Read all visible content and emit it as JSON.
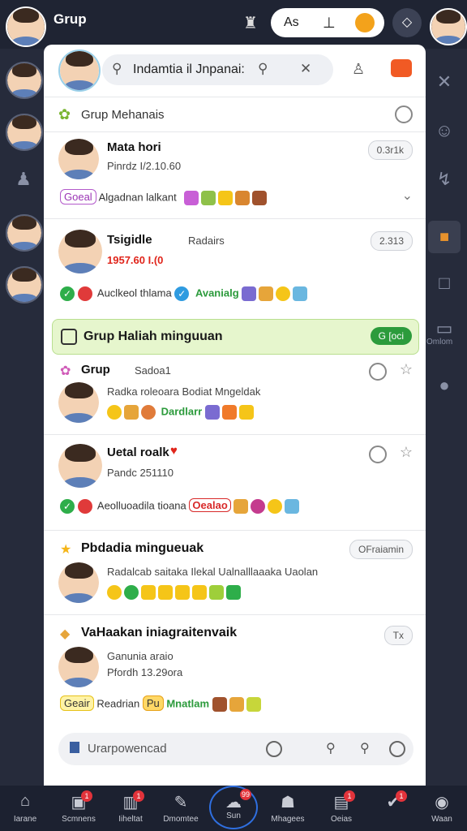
{
  "topbar": {
    "title": "Grup",
    "pill_text": "As"
  },
  "search": {
    "value": "Indamtia il Jnpanai:"
  },
  "section": {
    "title": "Grup Mehanais"
  },
  "rows": [
    {
      "name": "Mata hori",
      "sub": "Pinrdz I/2.10.60",
      "badge": "0.3r1k",
      "tag": "Goeal",
      "line": "Algadnan lalkant"
    },
    {
      "name": "Tsigidle",
      "sub": "1957.60 I.(0",
      "badge": "2.313",
      "extra": "Radairs",
      "line": "Auclkeol thlama",
      "tag2": "Avanialg"
    },
    {
      "name": "Grup",
      "sub": "Radka roleoara Bodiat Mngeldak",
      "extra": "Sadoa1",
      "line": "Dardlarr"
    },
    {
      "name": "Uetal roalk",
      "sub": "Pandc 251110",
      "line": "Aeolluoadila tioana",
      "tag": "Oealao"
    },
    {
      "name": "Pbdadia mingueuak",
      "sub": "Radalcab saitaka Ilekal Ualnalllaaaka Uaolan",
      "badge": "OFraiamin"
    },
    {
      "name": "VaHaakan iniagraitenvaik",
      "sub": "Ganunia araio",
      "sub2": "Pfordh 13.29ora",
      "badge": "Tx",
      "tag": "Geair",
      "line": "Readrian",
      "tag2": "Pu",
      "tag3": "Mnatlam"
    }
  ],
  "banner": {
    "title": "Grup Haliah minguuan",
    "badge": "G [oci"
  },
  "footer": {
    "placeholder": "Urarpowencad"
  },
  "side_label": "Omlom",
  "tabs": [
    {
      "label": "Iarane",
      "icon": "home-icon",
      "badge": ""
    },
    {
      "label": "Scmnens",
      "icon": "inbox-icon",
      "badge": "1"
    },
    {
      "label": "Iiheltat",
      "icon": "grid-icon",
      "badge": "1"
    },
    {
      "label": "Dmomtee",
      "icon": "tools-icon",
      "badge": ""
    },
    {
      "label": "Sun",
      "icon": "cloud-icon",
      "badge": "99"
    },
    {
      "label": "Mhagees",
      "icon": "people-icon",
      "badge": ""
    },
    {
      "label": "Oeias",
      "icon": "doc-icon",
      "badge": "1"
    },
    {
      "label": "",
      "icon": "check-icon",
      "badge": "1"
    },
    {
      "label": "Waan",
      "icon": "circle-icon",
      "badge": ""
    }
  ]
}
